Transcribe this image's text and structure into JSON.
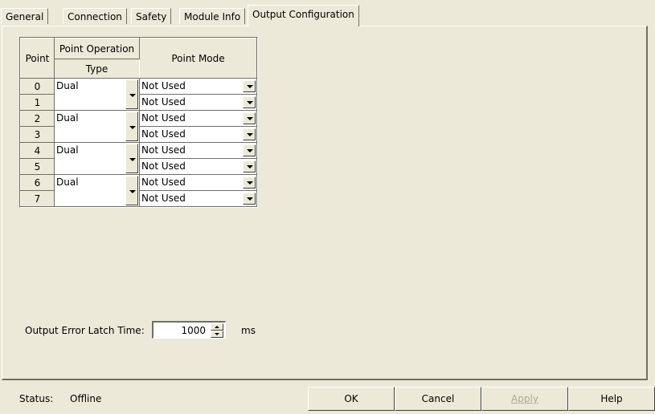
{
  "tabs": [
    {
      "label": "General"
    },
    {
      "label": "Connection"
    },
    {
      "label": "Safety"
    },
    {
      "label": "Module Info"
    },
    {
      "label": "Output Configuration"
    }
  ],
  "grid": {
    "header_point": "Point",
    "header_operation": "Point Operation",
    "header_type": "Type",
    "header_mode": "Point Mode",
    "pairs": [
      {
        "operation": "Dual",
        "points": [
          "0",
          "1"
        ],
        "modes": [
          "Not Used",
          "Not Used"
        ]
      },
      {
        "operation": "Dual",
        "points": [
          "2",
          "3"
        ],
        "modes": [
          "Not Used",
          "Not Used"
        ]
      },
      {
        "operation": "Dual",
        "points": [
          "4",
          "5"
        ],
        "modes": [
          "Not Used",
          "Not Used"
        ]
      },
      {
        "operation": "Dual",
        "points": [
          "6",
          "7"
        ],
        "modes": [
          "Not Used",
          "Not Used"
        ]
      }
    ]
  },
  "latch": {
    "label": "Output Error Latch Time:",
    "value": "1000",
    "unit": "ms"
  },
  "status": {
    "label": "Status:",
    "value": "Offline"
  },
  "buttons": {
    "ok": "OK",
    "cancel": "Cancel",
    "apply": "Apply",
    "help": "Help"
  }
}
